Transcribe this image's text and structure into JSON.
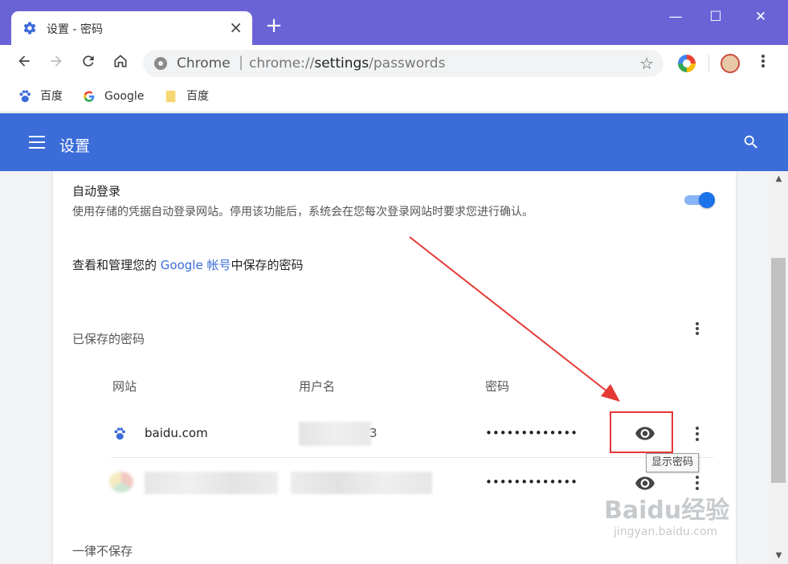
{
  "browser": {
    "tab": {
      "title": "设置 - 密码",
      "close": "×",
      "favicon": "gear-icon"
    },
    "new_tab": "+",
    "window_controls": {
      "minimize": "—",
      "maximize": "☐",
      "close": "✕"
    },
    "omnibox": {
      "origin": "Chrome",
      "separator": "|",
      "url_prefix": "chrome://",
      "url_host": "settings",
      "url_path": "/passwords"
    },
    "bookmarks": [
      {
        "label": "百度",
        "icon": "baidu-paw-icon"
      },
      {
        "label": "Google",
        "icon": "google-g-icon"
      },
      {
        "label": "百度",
        "icon": "folder-icon"
      }
    ]
  },
  "settings": {
    "header_title": "设置",
    "auto_signin": {
      "title": "自动登录",
      "description": "使用存储的凭据自动登录网站。停用该功能后，系统会在您每次登录网站时要求您进行确认。",
      "enabled": true
    },
    "manage": {
      "prefix": "查看和管理您的 ",
      "link": "Google 帐号",
      "suffix": "中保存的密码"
    },
    "saved_passwords": {
      "label": "已保存的密码",
      "columns": {
        "site": "网站",
        "username": "用户名",
        "password": "密码"
      },
      "rows": [
        {
          "site": "baidu.com",
          "username_visible": "3",
          "password": "•••••••••••••"
        },
        {
          "site": "",
          "username_visible": "",
          "password": "•••••••••••••"
        }
      ],
      "tooltip": "显示密码"
    },
    "never_saved_label": "一律不保存"
  },
  "watermark": {
    "main": "Baidu经验",
    "sub": "jingyan.baidu.com"
  },
  "colors": {
    "title_bar": "#6a63d6",
    "settings_header": "#3b6cd8",
    "highlight": "#e53935",
    "toggle": "#1a73e8"
  }
}
